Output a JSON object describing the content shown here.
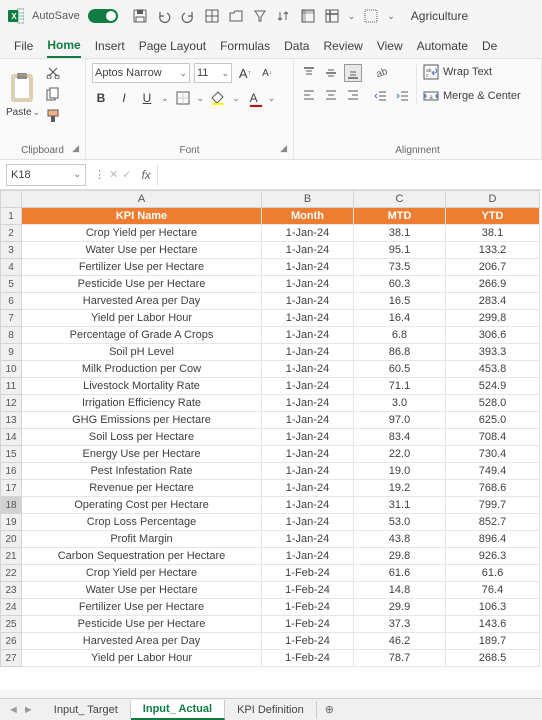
{
  "title": {
    "autosave": "AutoSave",
    "filename": "Agriculture"
  },
  "tabs": {
    "file": "File",
    "home": "Home",
    "insert": "Insert",
    "page_layout": "Page Layout",
    "formulas": "Formulas",
    "data": "Data",
    "review": "Review",
    "view": "View",
    "automate": "Automate",
    "dev": "De"
  },
  "ribbon": {
    "clipboard": {
      "paste": "Paste",
      "label": "Clipboard"
    },
    "font": {
      "name": "Aptos Narrow",
      "size": "11",
      "label": "Font"
    },
    "alignment": {
      "wrap": "Wrap Text",
      "merge": "Merge & Center",
      "label": "Alignment"
    }
  },
  "namebox": {
    "ref": "K18"
  },
  "columns": [
    "A",
    "B",
    "C",
    "D"
  ],
  "header_row": {
    "A": "KPI Name",
    "B": "Month",
    "C": "MTD",
    "D": "YTD"
  },
  "rows": [
    {
      "n": "2",
      "A": "Crop Yield per Hectare",
      "B": "1-Jan-24",
      "C": "38.1",
      "D": "38.1"
    },
    {
      "n": "3",
      "A": "Water Use per Hectare",
      "B": "1-Jan-24",
      "C": "95.1",
      "D": "133.2"
    },
    {
      "n": "4",
      "A": "Fertilizer Use per Hectare",
      "B": "1-Jan-24",
      "C": "73.5",
      "D": "206.7"
    },
    {
      "n": "5",
      "A": "Pesticide Use per Hectare",
      "B": "1-Jan-24",
      "C": "60.3",
      "D": "266.9"
    },
    {
      "n": "6",
      "A": "Harvested Area per Day",
      "B": "1-Jan-24",
      "C": "16.5",
      "D": "283.4"
    },
    {
      "n": "7",
      "A": "Yield per Labor Hour",
      "B": "1-Jan-24",
      "C": "16.4",
      "D": "299.8"
    },
    {
      "n": "8",
      "A": "Percentage of Grade A Crops",
      "B": "1-Jan-24",
      "C": "6.8",
      "D": "306.6"
    },
    {
      "n": "9",
      "A": "Soil pH Level",
      "B": "1-Jan-24",
      "C": "86.8",
      "D": "393.3"
    },
    {
      "n": "10",
      "A": "Milk Production per Cow",
      "B": "1-Jan-24",
      "C": "60.5",
      "D": "453.8"
    },
    {
      "n": "11",
      "A": "Livestock Mortality Rate",
      "B": "1-Jan-24",
      "C": "71.1",
      "D": "524.9"
    },
    {
      "n": "12",
      "A": "Irrigation Efficiency Rate",
      "B": "1-Jan-24",
      "C": "3.0",
      "D": "528.0"
    },
    {
      "n": "13",
      "A": "GHG Emissions per Hectare",
      "B": "1-Jan-24",
      "C": "97.0",
      "D": "625.0"
    },
    {
      "n": "14",
      "A": "Soil Loss per Hectare",
      "B": "1-Jan-24",
      "C": "83.4",
      "D": "708.4"
    },
    {
      "n": "15",
      "A": "Energy Use per Hectare",
      "B": "1-Jan-24",
      "C": "22.0",
      "D": "730.4"
    },
    {
      "n": "16",
      "A": "Pest Infestation Rate",
      "B": "1-Jan-24",
      "C": "19.0",
      "D": "749.4"
    },
    {
      "n": "17",
      "A": "Revenue per Hectare",
      "B": "1-Jan-24",
      "C": "19.2",
      "D": "768.6"
    },
    {
      "n": "18",
      "A": "Operating Cost per Hectare",
      "B": "1-Jan-24",
      "C": "31.1",
      "D": "799.7"
    },
    {
      "n": "19",
      "A": "Crop Loss Percentage",
      "B": "1-Jan-24",
      "C": "53.0",
      "D": "852.7"
    },
    {
      "n": "20",
      "A": "Profit Margin",
      "B": "1-Jan-24",
      "C": "43.8",
      "D": "896.4"
    },
    {
      "n": "21",
      "A": "Carbon Sequestration per Hectare",
      "B": "1-Jan-24",
      "C": "29.8",
      "D": "926.3"
    },
    {
      "n": "22",
      "A": "Crop Yield per Hectare",
      "B": "1-Feb-24",
      "C": "61.6",
      "D": "61.6"
    },
    {
      "n": "23",
      "A": "Water Use per Hectare",
      "B": "1-Feb-24",
      "C": "14.8",
      "D": "76.4"
    },
    {
      "n": "24",
      "A": "Fertilizer Use per Hectare",
      "B": "1-Feb-24",
      "C": "29.9",
      "D": "106.3"
    },
    {
      "n": "25",
      "A": "Pesticide Use per Hectare",
      "B": "1-Feb-24",
      "C": "37.3",
      "D": "143.6"
    },
    {
      "n": "26",
      "A": "Harvested Area per Day",
      "B": "1-Feb-24",
      "C": "46.2",
      "D": "189.7"
    },
    {
      "n": "27",
      "A": "Yield per Labor Hour",
      "B": "1-Feb-24",
      "C": "78.7",
      "D": "268.5"
    }
  ],
  "sheet_tabs": {
    "t1": "Input_ Target",
    "t2": "Input_ Actual",
    "t3": "KPI Definition"
  }
}
